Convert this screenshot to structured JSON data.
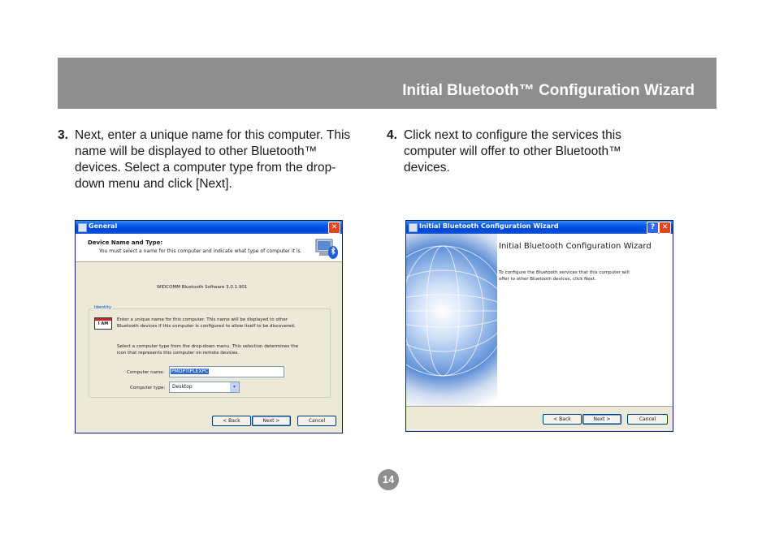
{
  "header": {
    "title": "Initial Bluetooth™ Configuration Wizard"
  },
  "steps": [
    {
      "number": "3.",
      "text": "Next, enter a unique name for this computer. This name will be displayed to other Bluetooth™ devices. Select a computer type from the drop-down menu and click [Next]."
    },
    {
      "number": "4.",
      "text": "Click next to configure the services this computer will offer to other Bluetooth™ devices."
    }
  ],
  "general_dialog": {
    "title": "General",
    "heading": "Device Name and Type:",
    "subheading": "You must select a name for this computer and indicate what type of computer it is.",
    "version": "WIDCOMM Bluetooth Software 3.0.1.901",
    "group_label": "Identity",
    "name_icon_text": "I AM",
    "name_instructions_1": "Enter a unique name for this computer.  This name will be displayed to other",
    "name_instructions_2": "Bluetooth devices if this computer is configured to allow itself to be discovered.",
    "type_instructions_1": "Select a computer type from the drop-down menu.  This selection determines the",
    "type_instructions_2": "icon that represents this computer on remote devices.",
    "computer_name_label": "Computer name:",
    "computer_name_value": "PMOPTIPLEXPC",
    "computer_type_label": "Computer type:",
    "computer_type_value": "Desktop",
    "back_label": "< Back",
    "next_label": "Next >",
    "cancel_label": "Cancel"
  },
  "wizard_dialog": {
    "title": "Initial Bluetooth Configuration Wizard",
    "heading": "Initial Bluetooth Configuration Wizard",
    "description_1": "To configure the Bluetooth services that this computer will",
    "description_2": "offer to other Bluetooth devices, click Next.",
    "back_label": "< Back",
    "next_label": "Next >",
    "cancel_label": "Cancel"
  },
  "page_number": "14",
  "colors": {
    "header_bar": "#8e8e8e",
    "xp_titlebar": "#0055e5",
    "dialog_face": "#ece9d8"
  }
}
